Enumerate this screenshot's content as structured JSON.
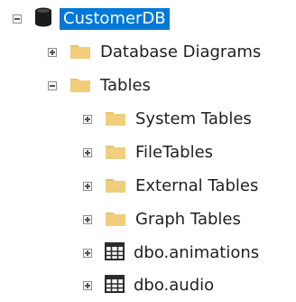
{
  "tree": {
    "root": {
      "label": "CustomerDB",
      "expanded": true,
      "selected": true,
      "icon": "database-icon"
    },
    "children": [
      {
        "label": "Database Diagrams",
        "expanded": false,
        "icon": "folder-icon"
      },
      {
        "label": "Tables",
        "expanded": true,
        "icon": "folder-icon"
      }
    ],
    "tables_children": [
      {
        "label": "System Tables",
        "expanded": false,
        "icon": "folder-icon"
      },
      {
        "label": "FileTables",
        "expanded": false,
        "icon": "folder-icon"
      },
      {
        "label": "External Tables",
        "expanded": false,
        "icon": "folder-icon"
      },
      {
        "label": "Graph Tables",
        "expanded": false,
        "icon": "folder-icon"
      },
      {
        "label": "dbo.animations",
        "expanded": false,
        "icon": "table-icon"
      },
      {
        "label": "dbo.audio",
        "expanded": false,
        "icon": "table-icon"
      }
    ]
  },
  "colors": {
    "selection": "#0078d7",
    "folder": "#e6c26b",
    "database": "#1b1b1b"
  }
}
